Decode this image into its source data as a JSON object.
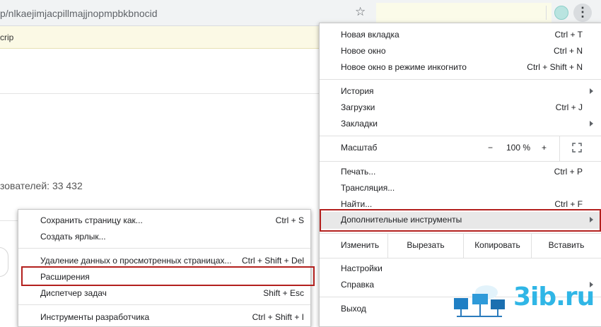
{
  "browser": {
    "url": "p/nlkaejimjacpillmajjnopmpbkbnocid",
    "infobar_text": "crip"
  },
  "page": {
    "users_text": "зователей: 33 432"
  },
  "main_menu": {
    "items": [
      {
        "label": "Новая вкладка",
        "shortcut": "Ctrl + T"
      },
      {
        "label": "Новое окно",
        "shortcut": "Ctrl + N"
      },
      {
        "label": "Новое окно в режиме инкогнито",
        "shortcut": "Ctrl + Shift + N"
      },
      {
        "label": "История",
        "shortcut": ""
      },
      {
        "label": "Загрузки",
        "shortcut": "Ctrl + J"
      },
      {
        "label": "Закладки",
        "shortcut": ""
      },
      {
        "label": "Печать...",
        "shortcut": "Ctrl + P"
      },
      {
        "label": "Трансляция...",
        "shortcut": ""
      },
      {
        "label": "Найти...",
        "shortcut": "Ctrl + F"
      },
      {
        "label": "Дополнительные инструменты",
        "shortcut": ""
      },
      {
        "label": "Настройки",
        "shortcut": ""
      },
      {
        "label": "Справка",
        "shortcut": ""
      },
      {
        "label": "Выход",
        "shortcut": ""
      }
    ],
    "zoom": {
      "label": "Масштаб",
      "minus": "−",
      "value": "100 %",
      "plus": "+"
    },
    "edit": {
      "label": "Изменить",
      "cut": "Вырезать",
      "copy": "Копировать",
      "paste": "Вставить"
    }
  },
  "sub_menu": {
    "items": [
      {
        "label": "Сохранить страницу как...",
        "shortcut": "Ctrl + S"
      },
      {
        "label": "Создать ярлык...",
        "shortcut": ""
      },
      {
        "label": "Удаление данных о просмотренных страницах...",
        "shortcut": "Ctrl + Shift + Del"
      },
      {
        "label": "Расширения",
        "shortcut": ""
      },
      {
        "label": "Диспетчер задач",
        "shortcut": "Shift + Esc"
      },
      {
        "label": "Инструменты разработчика",
        "shortcut": "Ctrl + Shift + I"
      }
    ]
  },
  "watermark": {
    "text": "3ib.ru"
  },
  "colors": {
    "highlight": "#b3201e",
    "watermark": "#30b6e6"
  }
}
